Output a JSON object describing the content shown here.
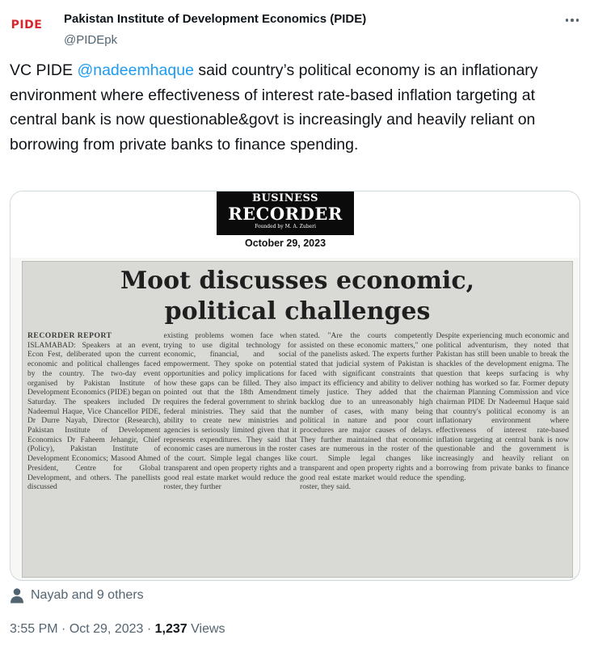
{
  "author": {
    "avatar_text": "PIDE",
    "name": "Pakistan Institute of Development Economics (PIDE)",
    "handle": "@PIDEpk"
  },
  "tweet": {
    "text_before": "VC PIDE ",
    "mention": "@nadeemhaque",
    "text_after": " said country’s political economy is an inflationary environment where effectiveness of interest rate-based inflation targeting at central bank is now questionable&govt is increasingly and heavily reliant on borrowing from private banks to finance spending."
  },
  "clipping": {
    "masthead_top": "BUSINESS",
    "masthead_main": "RECORDER",
    "masthead_founded": "Founded by M. A. Zuberi",
    "date": "October 29, 2023",
    "headline_line1": "Moot discusses economic,",
    "headline_line2": "political challenges",
    "columns": [
      "ISLAMABAD: Speakers at an event, Econ Fest, deliberated upon the current economic and political challenges faced by the country. The two-day event organised by Pakistan Institute of Development Economics (PIDE) began on Saturday. The speakers included Dr Nadeemul Haque, Vice Chancellor PIDE, Dr Durre Nayab, Director (Research), Pakistan Institute of Development Economics Dr Faheem Jehangir, Chief (Policy), Pakistan Institute of Development Economics; Masood Ahmed President, Centre for Global Development, and others. The panellists discussed",
      "existing problems women face when trying to use digital technology for economic, financial, and social empowerment. They spoke on potential opportunities and policy implications for how these gaps can be filled. They also pointed out that the 18th Amendment requires the federal government to shrink federal ministries. They said that the ability to create new ministries and agencies is seriously limited given that it represents expenditures. They said that economic cases are numerous in the roster of the court. Simple legal changes like transparent and open property rights and a good real estate market would reduce the roster, they further",
      "stated. \"Are the courts competently assisted on these economic matters,\" one of the panelists asked. The experts further stated that judicial system of Pakistan is faced with significant constraints that impact its efficiency and ability to deliver timely justice. They added that the backlog due to an unreasonably high number of cases, with many being political in nature and poor court procedures are major causes of delays. They further maintained that economic cases are numerous in the roster of the court. Simple legal changes like transparent and open property rights and a good real estate market would reduce the roster, they said.",
      "Despite experiencing much economic and political adventurism, they noted that Pakistan has still been unable to break the shackles of the development enigma. The question that keeps surfacing is why nothing has worked so far. Former deputy chairman Planning Commission and vice chairman PIDE Dr Nadeemul Haque said that country's political economy is an inflationary environment where effectiveness of interest rate-based inflation targeting at central bank is now questionable and the government is increasingly and heavily reliant on borrowing from private banks to finance spending."
    ],
    "report_label": "RECORDER REPORT"
  },
  "likes": {
    "icon": "person-icon",
    "text": "Nayab and 9 others"
  },
  "meta": {
    "time": "3:55 PM",
    "separator": " · ",
    "date": "Oct 29, 2023",
    "views_count": "1,237",
    "views_label": " Views"
  },
  "colors": {
    "link": "#1d9bf0",
    "secondary_text": "#536471",
    "primary_text": "#0f1419",
    "border": "#cfd9de",
    "brand_red": "#d8252b",
    "brand_green": "#2e9c4a"
  }
}
